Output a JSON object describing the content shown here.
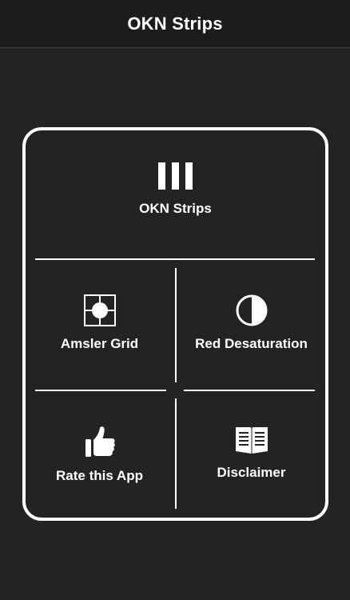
{
  "nav": {
    "title": "OKN Strips"
  },
  "menu": {
    "okn": {
      "label": "OKN Strips",
      "icon": "vertical-bars-icon"
    },
    "amsler": {
      "label": "Amsler Grid",
      "icon": "grid-target-icon"
    },
    "red": {
      "label": "Red Desaturation",
      "icon": "half-circle-contrast-icon"
    },
    "rate": {
      "label": "Rate this App",
      "icon": "thumbs-up-icon"
    },
    "disclaimer": {
      "label": "Disclaimer",
      "icon": "open-book-icon"
    }
  },
  "colors": {
    "background": "#232323",
    "nav_background": "#1c1c1c",
    "foreground": "#ffffff"
  }
}
